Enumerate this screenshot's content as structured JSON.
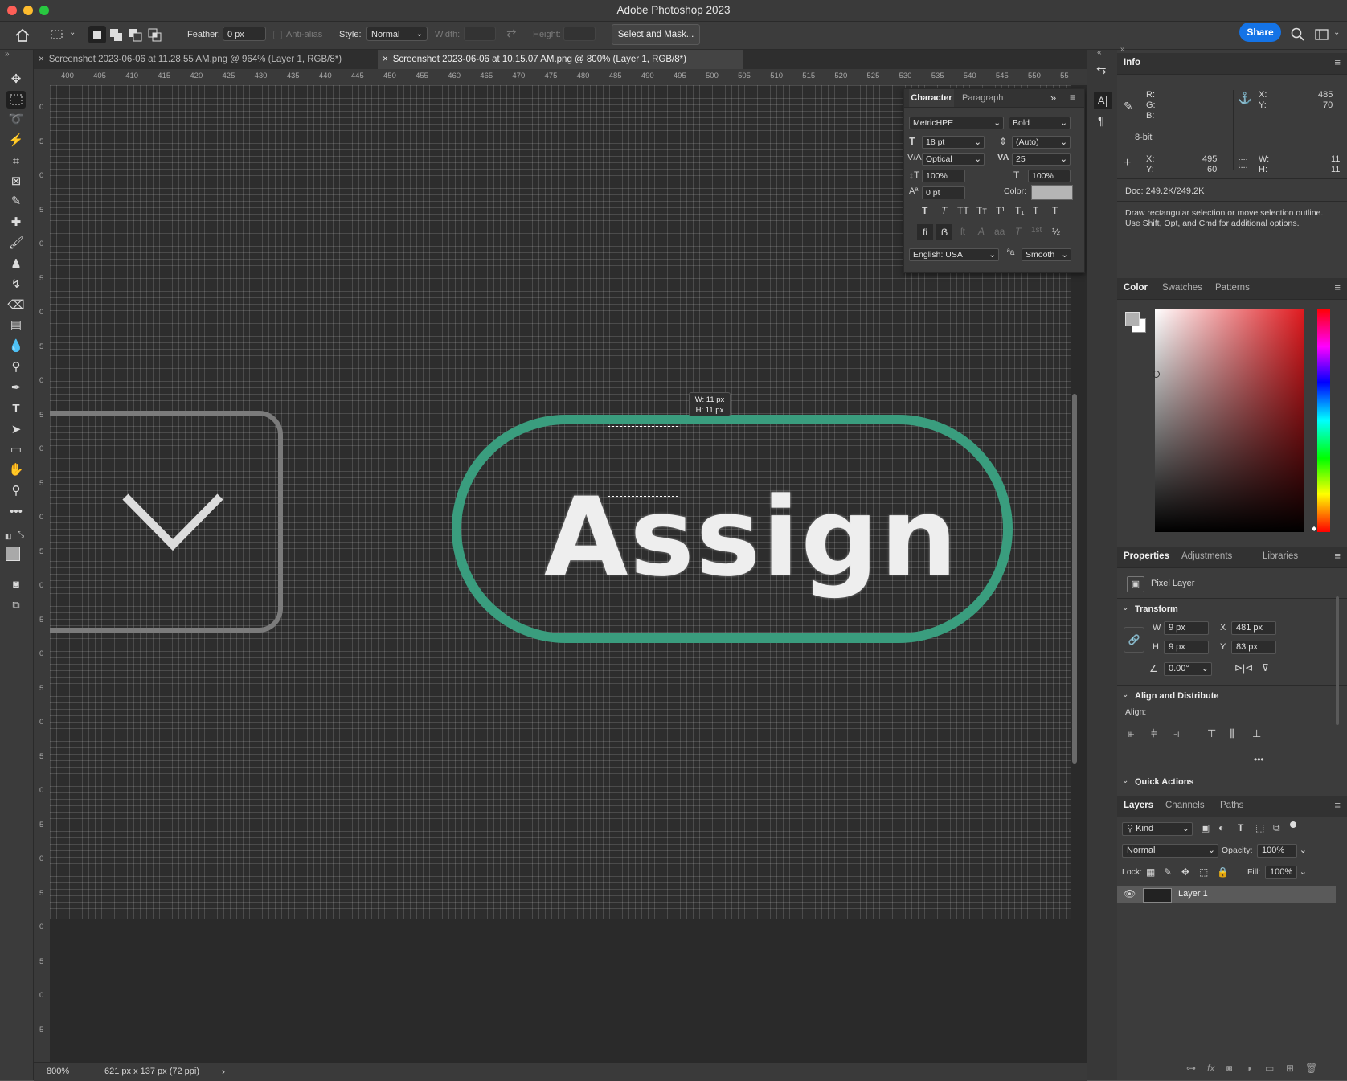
{
  "window": {
    "title": "Adobe Photoshop 2023"
  },
  "options_bar": {
    "feather_label": "Feather:",
    "feather_value": "0 px",
    "anti_alias_label": "Anti-alias",
    "style_label": "Style:",
    "style_value": "Normal",
    "width_label": "Width:",
    "height_label": "Height:",
    "select_mask_label": "Select and Mask...",
    "share_label": "Share"
  },
  "documents": [
    {
      "label": "Screenshot 2023-06-06 at 11.28.55 AM.png @ 964% (Layer 1, RGB/8*)",
      "active": false
    },
    {
      "label": "Screenshot 2023-06-06 at 10.15.07 AM.png @ 800% (Layer 1, RGB/8*)",
      "active": true
    }
  ],
  "ruler": {
    "top": [
      "400",
      "405",
      "410",
      "415",
      "420",
      "425",
      "430",
      "435",
      "440",
      "445",
      "450",
      "455",
      "460",
      "465",
      "470",
      "475",
      "480",
      "485",
      "490",
      "495",
      "500",
      "505",
      "510",
      "515",
      "520",
      "525",
      "530",
      "535",
      "540",
      "545",
      "550",
      "55"
    ],
    "left": [
      "0",
      "5",
      "0",
      "5",
      "0",
      "5",
      "0",
      "5",
      "0",
      "5",
      "0",
      "5",
      "0",
      "5",
      "0",
      "5",
      "0",
      "5",
      "0",
      "5",
      "0",
      "5",
      "0",
      "5",
      "0",
      "5",
      "0",
      "5"
    ]
  },
  "canvas": {
    "button_text": "Assign",
    "button_border_color": "#3a9d7e",
    "selection_tooltip_w": "W: 11 px",
    "selection_tooltip_h": "H: 11 px"
  },
  "status": {
    "zoom": "800%",
    "doc_size": "621 px x 137 px (72 ppi)"
  },
  "character_panel": {
    "tabs": [
      "Character",
      "Paragraph"
    ],
    "font_family": "MetricHPE",
    "font_style": "Bold",
    "size": "18 pt",
    "leading": "(Auto)",
    "kerning": "Optical",
    "tracking": "25",
    "vertical_scale": "100%",
    "horizontal_scale": "100%",
    "baseline_shift": "0 pt",
    "color_label": "Color:",
    "language": "English: USA",
    "antialias": "Smooth"
  },
  "info_panel": {
    "tab": "Info",
    "r_label": "R:",
    "g_label": "G:",
    "b_label": "B:",
    "bit_depth": "8-bit",
    "cursor_x_label": "X:",
    "cursor_x": "485",
    "cursor_y_label": "Y:",
    "cursor_y": "70",
    "sel_x_label": "X:",
    "sel_x": "495",
    "sel_y_label": "Y:",
    "sel_y": "60",
    "sel_w_label": "W:",
    "sel_w": "11",
    "sel_h_label": "H:",
    "sel_h": "11",
    "doc": "Doc: 249.2K/249.2K",
    "hint_line1": "Draw rectangular selection or move selection outline.",
    "hint_line2": "Use Shift, Opt, and Cmd for additional options."
  },
  "color_panel": {
    "tabs": [
      "Color",
      "Swatches",
      "Patterns"
    ],
    "hue_color": "#e0191e"
  },
  "properties_panel": {
    "tabs": [
      "Properties",
      "Adjustments",
      "Libraries"
    ],
    "kind": "Pixel Layer",
    "transform_title": "Transform",
    "w_label": "W",
    "w": "9 px",
    "x_label": "X",
    "x": "481 px",
    "h_label": "H",
    "h": "9 px",
    "y_label": "Y",
    "y": "83 px",
    "angle": "0.00°",
    "align_title": "Align and Distribute",
    "align_label": "Align:",
    "quick_actions": "Quick Actions"
  },
  "layers_panel": {
    "tabs": [
      "Layers",
      "Channels",
      "Paths"
    ],
    "filter": "Kind",
    "blend_mode": "Normal",
    "opacity_label": "Opacity:",
    "opacity": "100%",
    "lock_label": "Lock:",
    "fill_label": "Fill:",
    "fill": "100%",
    "layer_name": "Layer 1"
  }
}
